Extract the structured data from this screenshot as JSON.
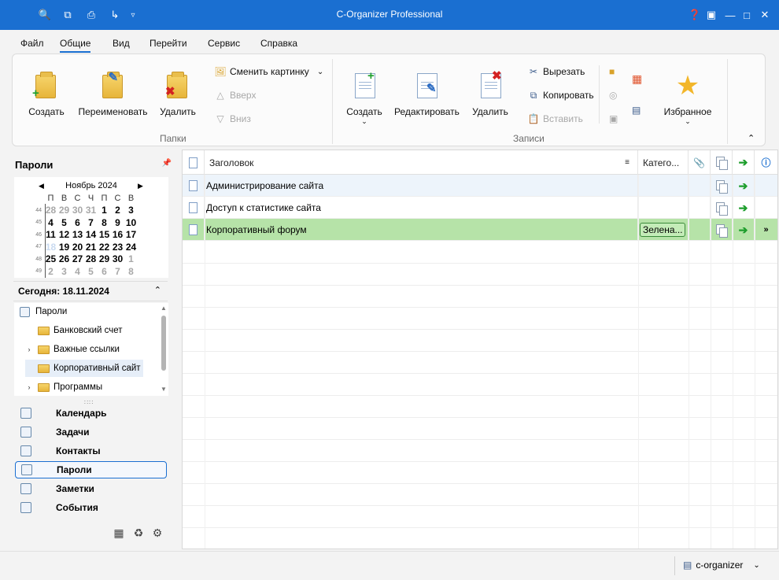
{
  "window": {
    "title": "C-Organizer Professional"
  },
  "menu": [
    "Файл",
    "Общие",
    "Вид",
    "Перейти",
    "Сервис",
    "Справка"
  ],
  "ribbon": {
    "folders_group": {
      "label": "Папки",
      "create": "Создать",
      "rename": "Переименовать",
      "delete": "Удалить",
      "change_picture": "Сменить картинку",
      "up": "Вверх",
      "down": "Вниз"
    },
    "records_group": {
      "label": "Записи",
      "create": "Создать",
      "edit": "Редактировать",
      "delete": "Удалить",
      "cut": "Вырезать",
      "copy": "Копировать",
      "paste": "Вставить"
    },
    "favorites": "Избранное"
  },
  "left": {
    "title": "Пароли",
    "calendar": {
      "month": "Ноябрь 2024",
      "dow": [
        "П",
        "В",
        "С",
        "Ч",
        "П",
        "С",
        "В"
      ],
      "weeks": [
        {
          "wk": "44",
          "days": [
            "28",
            "29",
            "30",
            "31",
            "1",
            "2",
            "3"
          ],
          "other": [
            0,
            1,
            2,
            3
          ]
        },
        {
          "wk": "45",
          "days": [
            "4",
            "5",
            "6",
            "7",
            "8",
            "9",
            "10"
          ],
          "other": []
        },
        {
          "wk": "46",
          "days": [
            "11",
            "12",
            "13",
            "14",
            "15",
            "16",
            "17"
          ],
          "other": []
        },
        {
          "wk": "47",
          "days": [
            "18",
            "19",
            "20",
            "21",
            "22",
            "23",
            "24"
          ],
          "other": [],
          "today": 0
        },
        {
          "wk": "48",
          "days": [
            "25",
            "26",
            "27",
            "28",
            "29",
            "30",
            "1"
          ],
          "other": [
            6
          ]
        },
        {
          "wk": "49",
          "days": [
            "2",
            "3",
            "4",
            "5",
            "6",
            "7",
            "8"
          ],
          "other": [
            0,
            1,
            2,
            3,
            4,
            5,
            6
          ]
        }
      ]
    },
    "today_label": "Сегодня: 18.11.2024",
    "tree": {
      "root": "Пароли",
      "items": [
        "Банковский счет",
        "Важные ссылки",
        "Корпоративный сайт",
        "Программы"
      ]
    },
    "nav": [
      "Календарь",
      "Задачи",
      "Контакты",
      "Пароли",
      "Заметки",
      "События"
    ]
  },
  "grid": {
    "columns": {
      "title": "Заголовок",
      "category": "Катего..."
    },
    "rows": [
      {
        "title": "Администрирование сайта",
        "category": ""
      },
      {
        "title": "Доступ к статистике сайта",
        "category": ""
      },
      {
        "title": "Корпоративный форум",
        "category": "Зелена..."
      }
    ]
  },
  "status": {
    "database": "c-organizer"
  },
  "colors": {
    "titlebar": "#1a6fd1",
    "selected_row": "#b6e3a8",
    "alt_row": "#edf4fb"
  }
}
